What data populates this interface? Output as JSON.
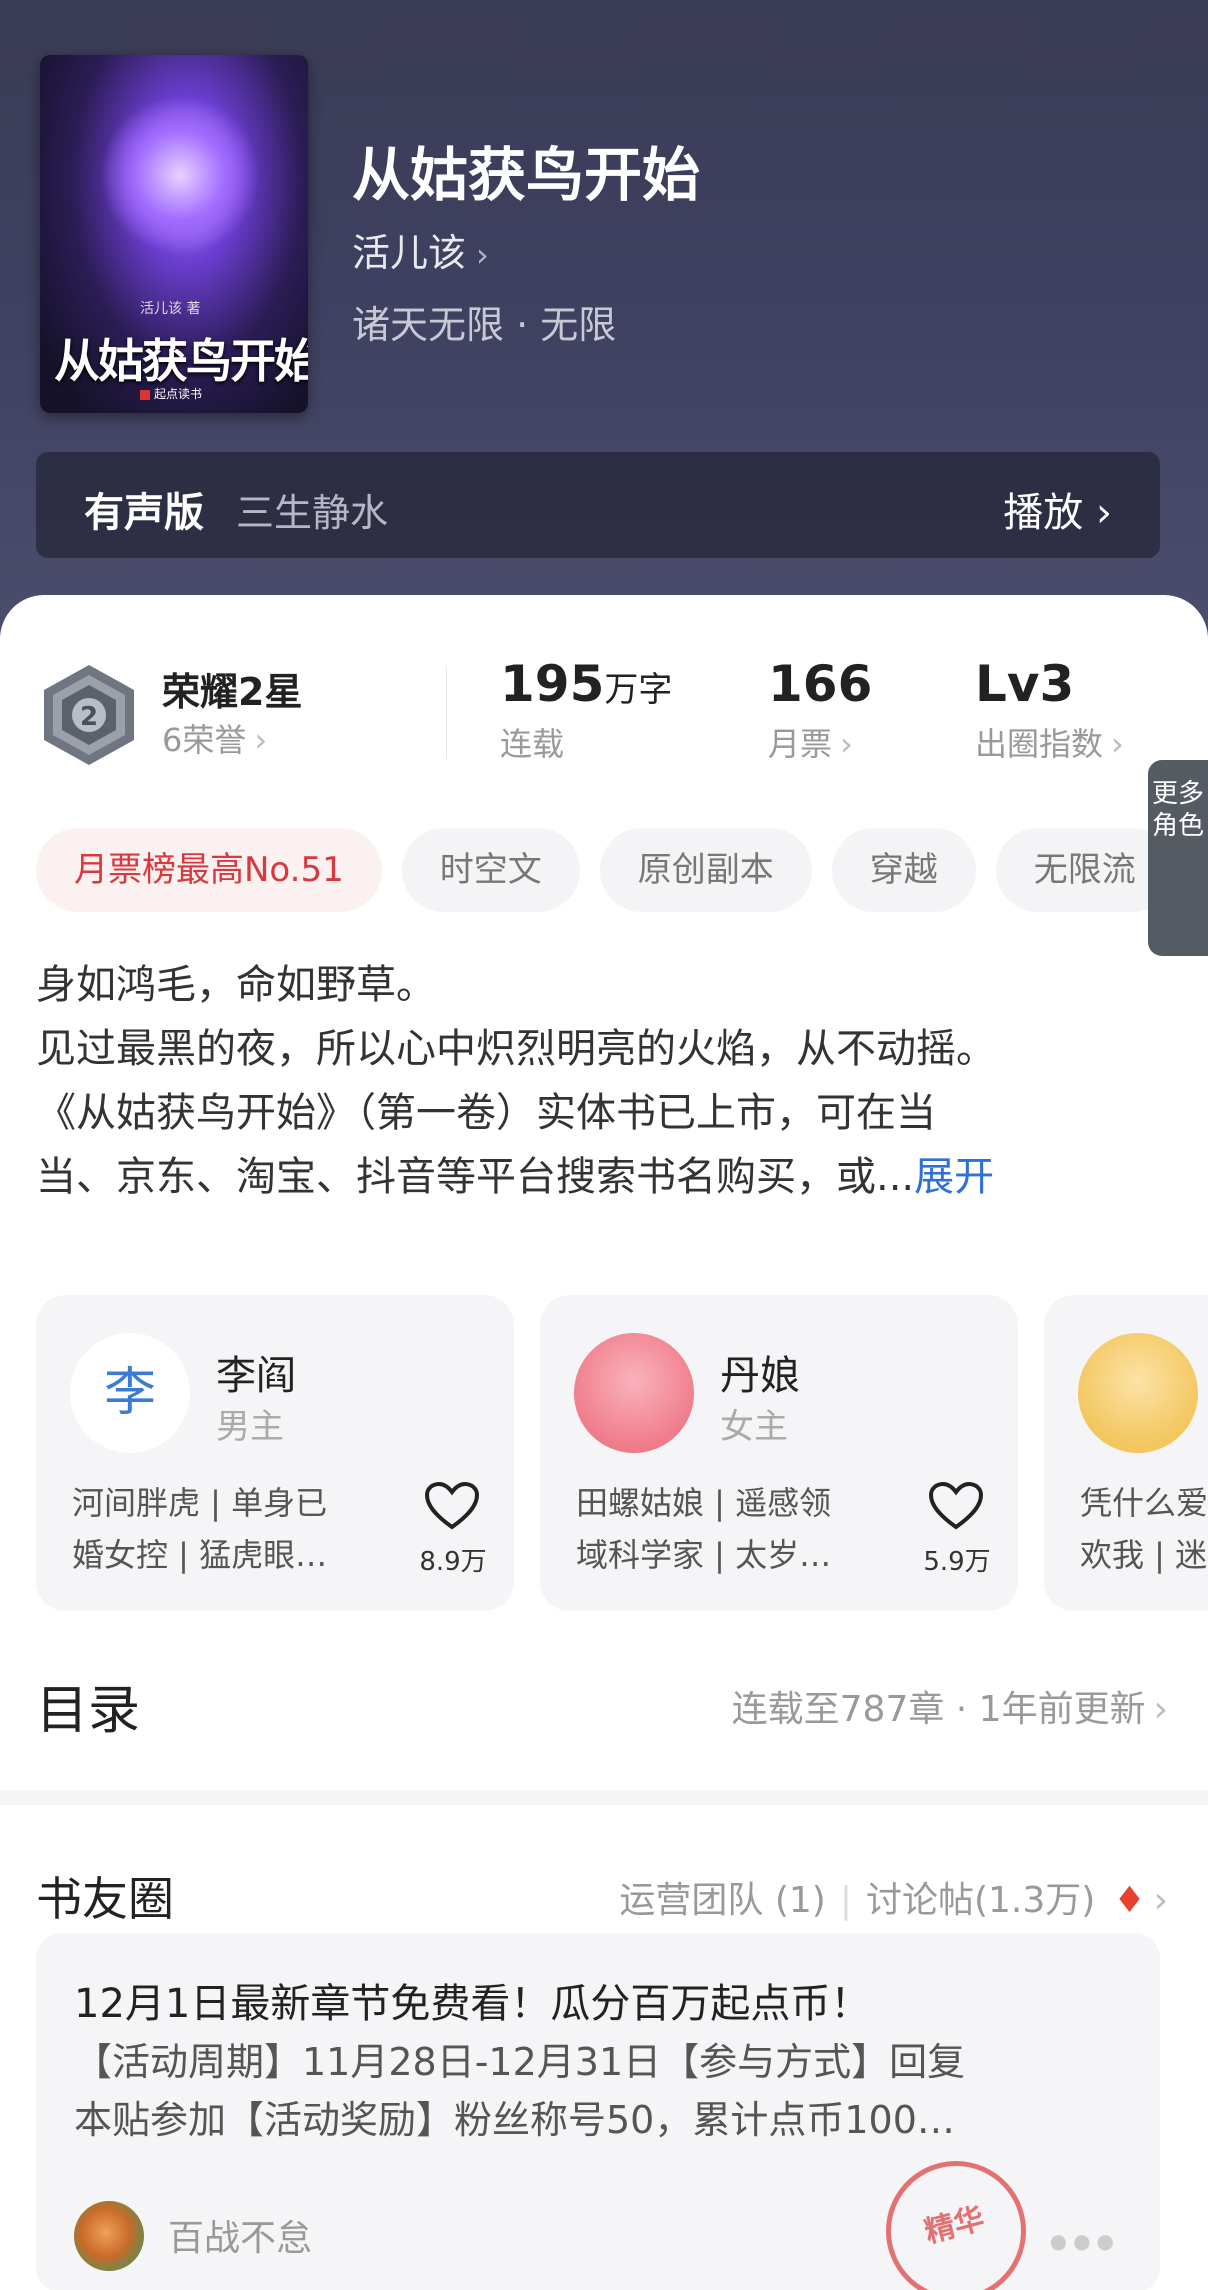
{
  "book": {
    "title": "从姑获鸟开始",
    "author": "活儿该",
    "genre": "诸天无限 · 无限",
    "cover": {
      "title_text": "从姑获鸟开始",
      "author_text": "活儿该 著",
      "publisher": "起点读书"
    }
  },
  "audio": {
    "label": "有声版",
    "narrator": "三生静水",
    "action": "播放"
  },
  "stats": {
    "honor_title": "荣耀2星",
    "honor_sub": "6荣誉",
    "badge_level": "2",
    "words_value": "195",
    "words_unit": "万字",
    "words_caption": "连载",
    "monthly_votes": "166",
    "monthly_caption": "月票",
    "level_value": "Lv3",
    "level_caption": "出圈指数"
  },
  "tags": [
    "月票榜最高No.51",
    "时空文",
    "原创副本",
    "穿越",
    "无限流"
  ],
  "synopsis": {
    "lines": [
      "身如鸿毛，命如野草。",
      "见过最黑的夜，所以心中炽烈明亮的火焰，从不动摇。",
      "《从姑获鸟开始》（第一卷）实体书已上市，可在当",
      "当、京东、淘宝、抖音等平台搜索书名购买，或..."
    ],
    "expand": "展开"
  },
  "roles": [
    {
      "avatar_text": "李",
      "name": "李阎",
      "type": "男主",
      "desc1": "河间胖虎 | 单身已",
      "desc2": "婚女控 | 猛虎眼…",
      "likes": "8.9万"
    },
    {
      "avatar_text": "",
      "name": "丹娘",
      "type": "女主",
      "desc1": "田螺姑娘 | 遥感领",
      "desc2": "域科学家 | 太岁…",
      "likes": "5.9万"
    },
    {
      "avatar_text": "",
      "name": "",
      "type": "",
      "desc1": "凭什么爱",
      "desc2": "欢我 | 迷",
      "likes": ""
    }
  ],
  "more_roles": "更多角色",
  "toc": {
    "heading": "目录",
    "info": "连载至787章 · 1年前更新"
  },
  "community": {
    "heading": "书友圈",
    "ops_team": "运营团队 (1)",
    "threads": "讨论帖(1.3万)",
    "post": {
      "title": "12月1日最新章节免费看！瓜分百万起点币！",
      "body_line1": "【活动周期】11月28日-12月31日【参与方式】回复",
      "body_line2": "本贴参加【活动奖励】粉丝称号50，累计点币100…",
      "user": "百战不怠",
      "stamp": "精华"
    }
  },
  "colors": {
    "hero_bg": "#3e4060",
    "accent_red": "#d8393f",
    "link_blue": "#2f6fd6"
  }
}
